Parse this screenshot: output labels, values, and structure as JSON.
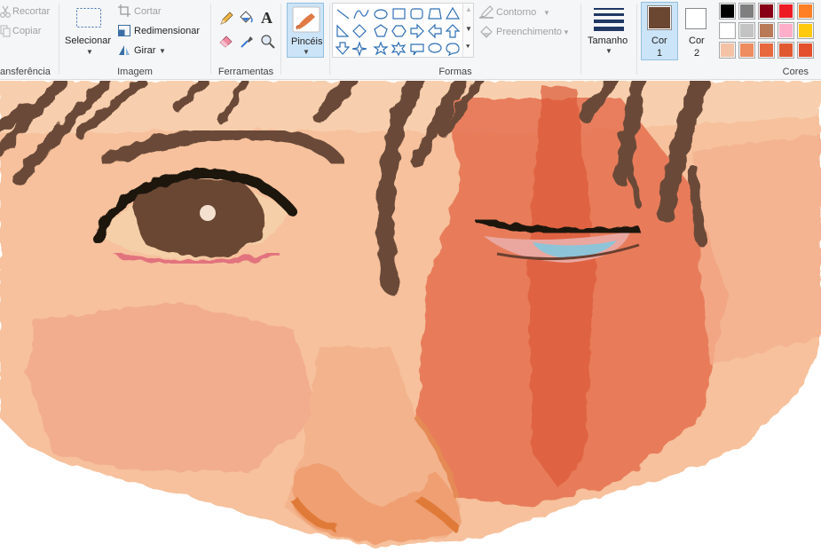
{
  "ribbon": {
    "clipboard": {
      "label": "ansferência",
      "cut": "Recortar",
      "copy": "Copiar"
    },
    "image": {
      "label": "Imagem",
      "select": "Selecionar",
      "crop": "Cortar",
      "resize": "Redimensionar",
      "rotate": "Girar"
    },
    "tools": {
      "label": "Ferramentas"
    },
    "brushes": {
      "label": "Pincéis"
    },
    "shapes": {
      "label": "Formas",
      "outline": "Contorno",
      "fill": "Preenchimento"
    },
    "size": {
      "label": "Tamanho"
    },
    "color1": {
      "label_a": "Cor",
      "label_b": "1",
      "value": "#6b4631"
    },
    "color2": {
      "label_a": "Cor",
      "label_b": "2",
      "value": "#ffffff"
    },
    "colors": {
      "label": "Cores",
      "palette": [
        [
          "#000000",
          "#7f7f7f",
          "#880015",
          "#ed1c24",
          "#ff7f27"
        ],
        [
          "#ffffff",
          "#c3c3c3",
          "#b97a57",
          "#ffaec9",
          "#ffc90e"
        ],
        [
          "#f4c2a5",
          "#ee8b5f",
          "#e8683e",
          "#e0592f",
          "#e4502b"
        ]
      ]
    }
  }
}
